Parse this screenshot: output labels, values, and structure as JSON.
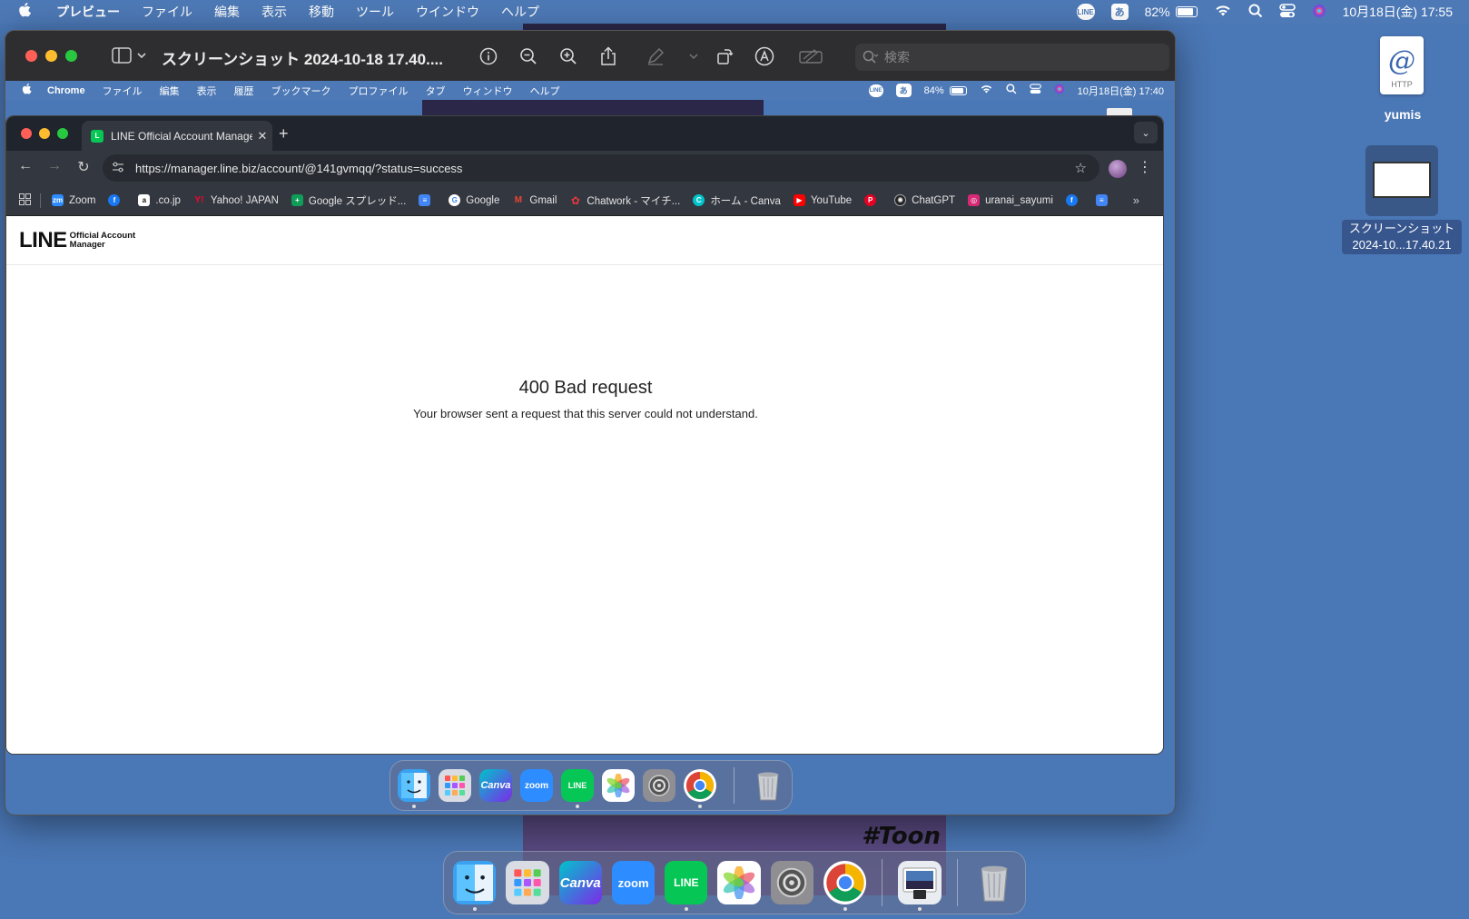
{
  "menubar": {
    "apple": "",
    "items": [
      "プレビュー",
      "ファイル",
      "編集",
      "表示",
      "移動",
      "ツール",
      "ウインドウ",
      "ヘルプ"
    ],
    "status": {
      "line_badge": "LINE",
      "input_mode": "あ",
      "battery": "82%",
      "datetime": "10月18日(金) 17:55"
    }
  },
  "preview": {
    "title": "スクリーンショット 2024-10-18 17.40....",
    "search_placeholder": "検索"
  },
  "inner_menubar": {
    "items": [
      "Chrome",
      "ファイル",
      "編集",
      "表示",
      "履歴",
      "ブックマーク",
      "プロファイル",
      "タブ",
      "ウィンドウ",
      "ヘルプ"
    ],
    "status": {
      "line_badge": "LINE",
      "input_mode": "あ",
      "battery": "84%",
      "datetime": "10月18日(金) 17:40"
    }
  },
  "chrome": {
    "tab_title": "LINE Official Account Manage",
    "url": "https://manager.line.biz/account/@141gvmqq/?status=success",
    "bookmarks": [
      {
        "label": "Zoom",
        "icon": "zoom-icon",
        "color": "#2d8cff"
      },
      {
        "label": "",
        "icon": "facebook-icon",
        "color": "#1877f2"
      },
      {
        "label": ".co.jp",
        "icon": "amazon-icon",
        "color": "#ffffff"
      },
      {
        "label": "Yahoo! JAPAN",
        "icon": "yahoo-icon",
        "color": "#ff0033"
      },
      {
        "label": "Google スプレッド...",
        "icon": "sheets-icon",
        "color": "#0f9d58"
      },
      {
        "label": "",
        "icon": "docs-icon",
        "color": "#4285f4"
      },
      {
        "label": "Google",
        "icon": "google-icon",
        "color": "#ffffff"
      },
      {
        "label": "Gmail",
        "icon": "gmail-icon",
        "color": "#ea4335"
      },
      {
        "label": "Chatwork - マイチ...",
        "icon": "chatwork-icon",
        "color": "#e2383f"
      },
      {
        "label": "ホーム - Canva",
        "icon": "canva-icon",
        "color": "#00c4cc"
      },
      {
        "label": "YouTube",
        "icon": "youtube-icon",
        "color": "#ff0000"
      },
      {
        "label": "",
        "icon": "pinterest-icon",
        "color": "#e60023"
      },
      {
        "label": "ChatGPT",
        "icon": "chatgpt-icon",
        "color": "#222222"
      },
      {
        "label": "uranai_sayumi",
        "icon": "instagram-icon",
        "color": "#d62976"
      },
      {
        "label": "",
        "icon": "facebook-icon",
        "color": "#1877f2"
      },
      {
        "label": "",
        "icon": "docs-icon",
        "color": "#4285f4"
      }
    ]
  },
  "page": {
    "logo_main": "LINE",
    "logo_sub_1": "Official Account",
    "logo_sub_2": "Manager",
    "error_title": "400 Bad request",
    "error_message": "Your browser sent a request that this server could not understand."
  },
  "dock_apps": [
    {
      "name": "Finder",
      "label": "",
      "color": "#3aa0f0",
      "running": true
    },
    {
      "name": "Launchpad",
      "label": "",
      "color": "#d9dde3",
      "running": false
    },
    {
      "name": "Canva",
      "label": "Canva",
      "color": "#7d2ae8",
      "running": false
    },
    {
      "name": "Zoom",
      "label": "zoom",
      "color": "#2d8cff",
      "running": false
    },
    {
      "name": "LINE",
      "label": "LINE",
      "color": "#06c755",
      "running": true
    },
    {
      "name": "Photos",
      "label": "",
      "color": "#ffffff",
      "running": false
    },
    {
      "name": "System Settings",
      "label": "",
      "color": "#8e8e93",
      "running": false
    },
    {
      "name": "Chrome",
      "label": "",
      "color": "#ffffff",
      "running": true
    }
  ],
  "desktop": {
    "http_file_label": "HTTP",
    "http_file_name": "yumis",
    "screenshot_name_1": "スクリーンショット",
    "screenshot_name_2": "2024-10...17.40.21"
  },
  "wallpaper_text": "#Toon"
}
